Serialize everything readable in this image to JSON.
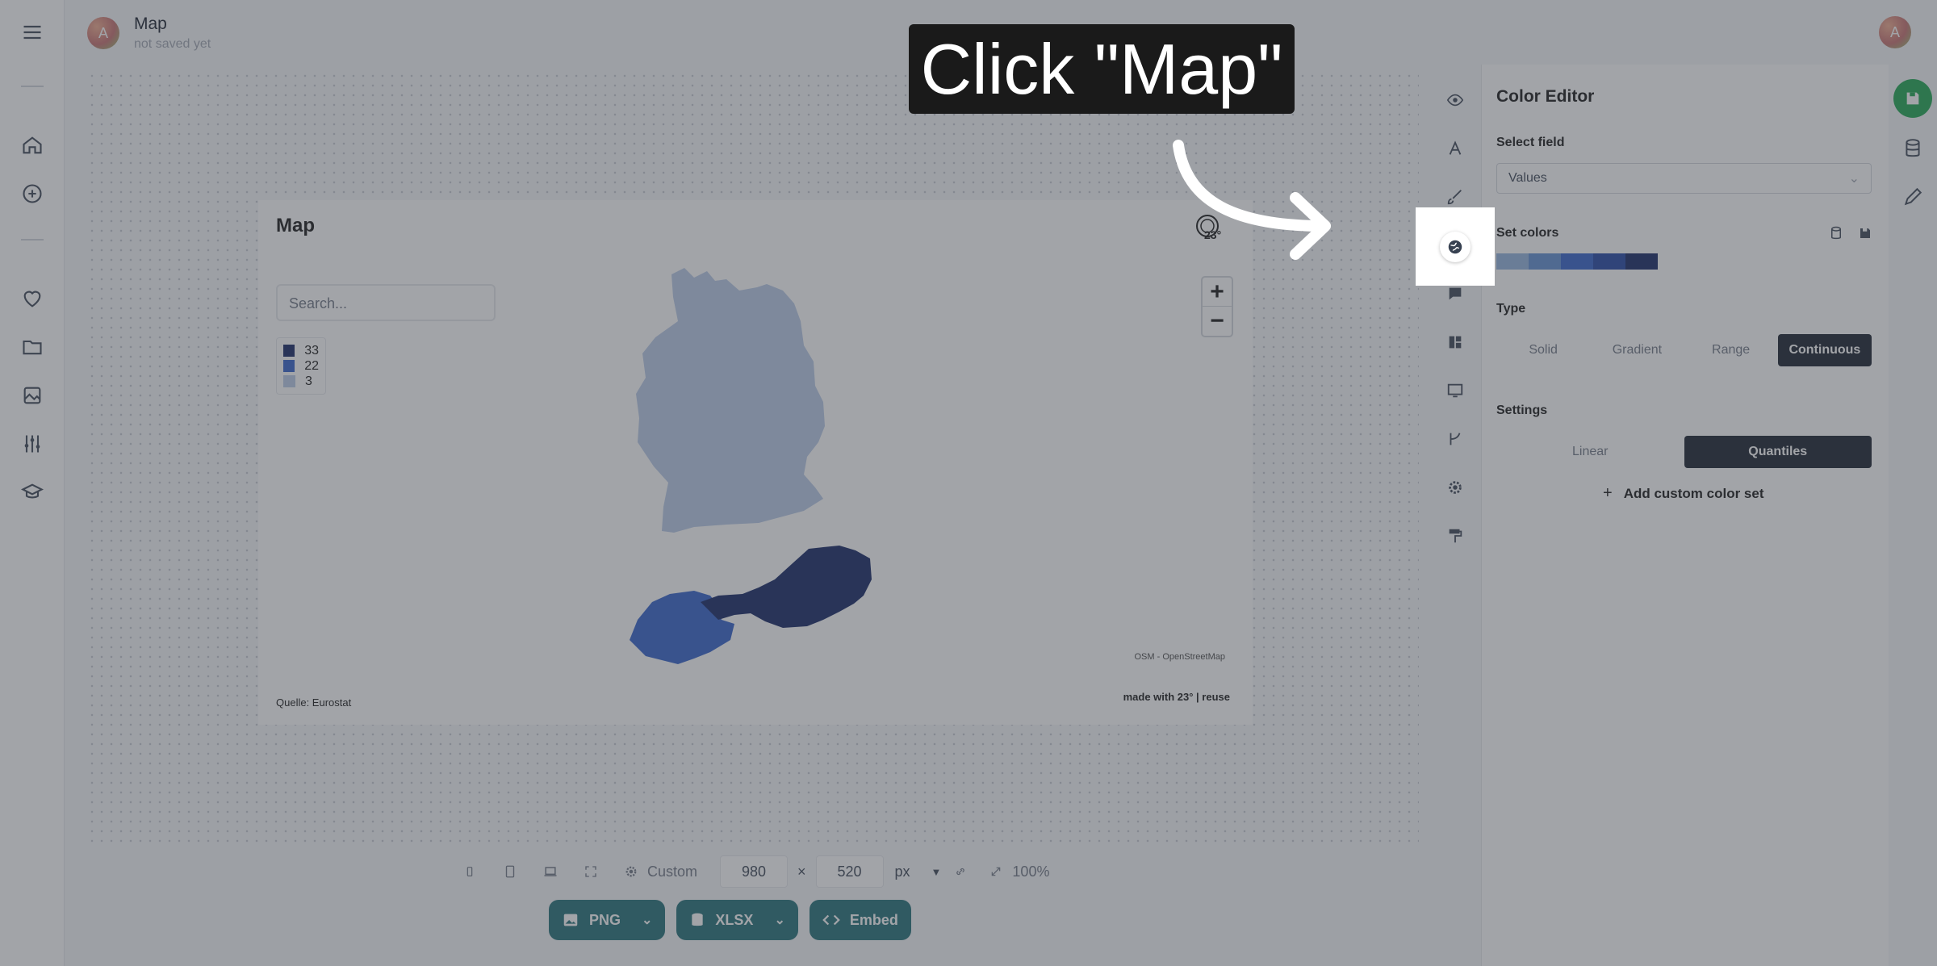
{
  "header": {
    "avatar_initial": "A",
    "doc_title": "Map",
    "doc_status": "not saved yet"
  },
  "left_rail": {
    "items": [
      "menu-icon",
      "home-icon",
      "add-circle-icon",
      "heart-icon",
      "folder-icon",
      "image-icon",
      "sliders-icon",
      "graduation-cap-icon"
    ]
  },
  "map_card": {
    "title": "Map",
    "search_placeholder": "Search...",
    "legend": [
      {
        "label": "33",
        "color": "#0c1f5e"
      },
      {
        "label": "22",
        "color": "#2d5cc8"
      },
      {
        "label": "3",
        "color": "#b6c8e6"
      }
    ],
    "zoom_in": "+",
    "zoom_out": "−",
    "osm_attribution": "OSM - OpenStreetMap",
    "source": "Quelle: Eurostat",
    "made_with": "made with 23° | reuse",
    "logo_text": "23°",
    "regions": [
      {
        "name": "Germany",
        "value": 3
      },
      {
        "name": "Switzerland",
        "value": 22
      },
      {
        "name": "Austria",
        "value": 33
      }
    ]
  },
  "size_bar": {
    "preset": "Custom",
    "width": "980",
    "times": "×",
    "height": "520",
    "unit": "px",
    "zoom": "100%"
  },
  "export": {
    "png": "PNG",
    "xlsx": "XLSX",
    "embed": "Embed"
  },
  "color_panel": {
    "title": "Color Editor",
    "select_field_label": "Select field",
    "select_field_value": "Values",
    "set_colors_label": "Set colors",
    "ramp": [
      "#8fb0dc",
      "#5b8bd0",
      "#2d5cc8",
      "#1a3ea0",
      "#0c1f5e"
    ],
    "type_label": "Type",
    "type_options": [
      "Solid",
      "Gradient",
      "Range",
      "Continuous"
    ],
    "type_active": "Continuous",
    "settings_label": "Settings",
    "settings_options": [
      "Linear",
      "Quantiles"
    ],
    "settings_active": "Quantiles",
    "add_custom": "Add custom color set"
  },
  "tabs": [
    "eye-icon",
    "text-icon",
    "brush-icon",
    "globe-icon",
    "comment-icon",
    "layout-icon",
    "screen-icon",
    "branch-icon",
    "gear-icon",
    "paint-roller-icon"
  ],
  "callout": {
    "text": "Click \"Map\""
  },
  "colors": {
    "accent": "#1b6a73",
    "save_green": "#16a34a",
    "dark": "#111827"
  }
}
